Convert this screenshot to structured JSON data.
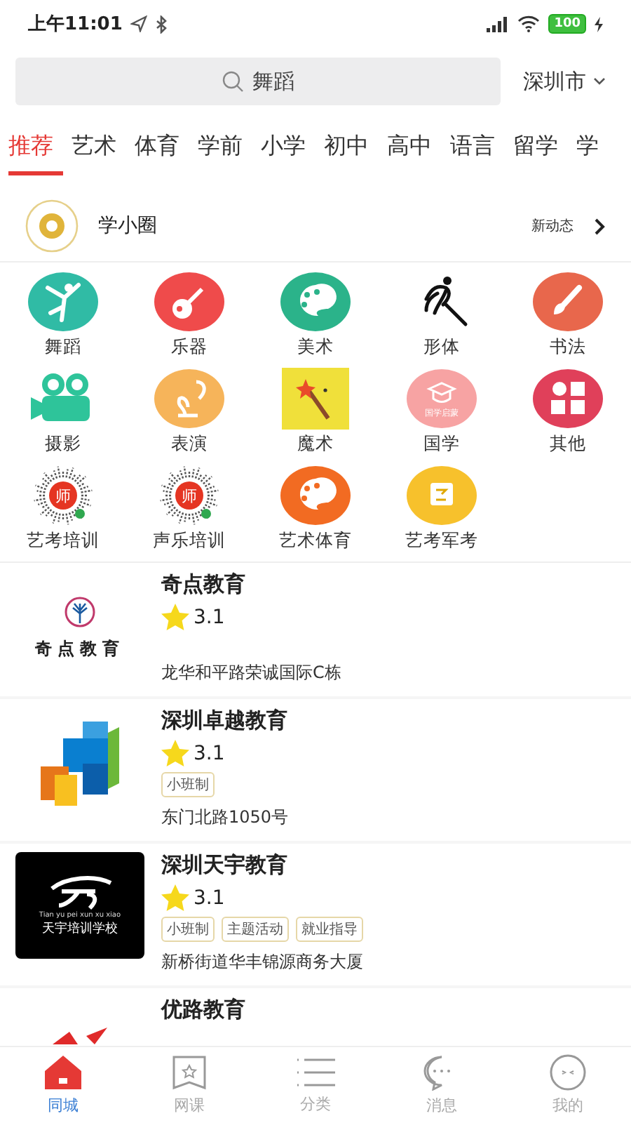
{
  "status_bar": {
    "time": "上午11:01",
    "battery": "100"
  },
  "search": {
    "value": "舞蹈",
    "city": "深圳市"
  },
  "tabs": [
    {
      "label": "推荐",
      "selected": true
    },
    {
      "label": "艺术",
      "selected": false
    },
    {
      "label": "体育",
      "selected": false
    },
    {
      "label": "学前",
      "selected": false
    },
    {
      "label": "小学",
      "selected": false
    },
    {
      "label": "初中",
      "selected": false
    },
    {
      "label": "高中",
      "selected": false
    },
    {
      "label": "语言",
      "selected": false
    },
    {
      "label": "留学",
      "selected": false
    },
    {
      "label": "学",
      "selected": false
    }
  ],
  "circle": {
    "title": "学小圈",
    "link": "新动态"
  },
  "categories": [
    {
      "label": "舞蹈"
    },
    {
      "label": "乐器"
    },
    {
      "label": "美术"
    },
    {
      "label": "形体"
    },
    {
      "label": "书法"
    },
    {
      "label": "摄影"
    },
    {
      "label": "表演"
    },
    {
      "label": "魔术"
    },
    {
      "label": "国学",
      "icon_text": "国学启蒙"
    },
    {
      "label": "其他"
    },
    {
      "label": "艺考培训",
      "icon_text": "师"
    },
    {
      "label": "声乐培训",
      "icon_text": "师"
    },
    {
      "label": "艺术体育"
    },
    {
      "label": "艺考军考"
    }
  ],
  "organizations": [
    {
      "name": "奇点教育",
      "logo_text": "奇点教育",
      "rating": "3.1",
      "address": "龙华和平路荣诚国际C栋"
    },
    {
      "name": "深圳卓越教育",
      "rating": "3.1",
      "tags": [
        "小班制"
      ],
      "address": "东门北路1050号"
    },
    {
      "name": "深圳天宇教育",
      "logo_text": "天宇培训学校",
      "logo_subtext": "Tian yu pei xun xu xiao",
      "rating": "3.1",
      "tags": [
        "小班制",
        "主题活动",
        "就业指导"
      ],
      "address": "新桥街道华丰锦源商务大厦"
    },
    {
      "name": "优路教育"
    }
  ],
  "nav": [
    {
      "label": "同城",
      "selected": true
    },
    {
      "label": "网课",
      "selected": false
    },
    {
      "label": "分类",
      "selected": false
    },
    {
      "label": "消息",
      "selected": false
    },
    {
      "label": "我的",
      "selected": false
    }
  ]
}
